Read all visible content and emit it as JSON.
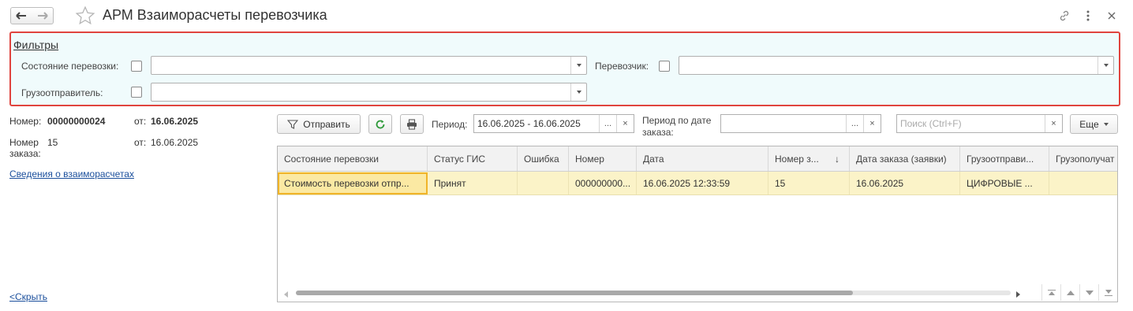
{
  "window": {
    "title": "АРМ Взаиморасчеты перевозчика"
  },
  "filters": {
    "header": "Фильтры",
    "state_label": "Состояние перевозки:",
    "carrier_label": "Перевозчик:",
    "shipper_label": "Грузоотправитель:"
  },
  "info": {
    "number_label": "Номер:",
    "number_value": "00000000024",
    "from_label_1": "от:",
    "date_1": "16.06.2025",
    "order_number_label_line1": "Номер",
    "order_number_label_line2": "заказа:",
    "order_number_value": "15",
    "from_label_2": "от:",
    "date_2": "16.06.2025",
    "settlements_link": "Сведения о взаиморасчетах",
    "hide_link": "<Скрыть"
  },
  "toolbar": {
    "send_label": "Отправить",
    "period_label": "Период:",
    "period_value": "16.06.2025 - 16.06.2025",
    "order_period_label_line1": "Период по дате",
    "order_period_label_line2": "заказа:",
    "search_placeholder": "Поиск (Ctrl+F)",
    "more_label": "Еще",
    "ellipsis": "...",
    "clear": "×"
  },
  "table": {
    "columns": [
      "Состояние перевозки",
      "Статус ГИС",
      "Ошибка",
      "Номер",
      "Дата",
      "Номер з...",
      "Дата заказа (заявки)",
      "Грузоотправи...",
      "Грузополучат"
    ],
    "sort_indicator": "↓",
    "rows": [
      {
        "state": "Стоимость перевозки отпр...",
        "gis_status": "Принят",
        "error": "",
        "number": "000000000...",
        "date": "16.06.2025 12:33:59",
        "order_number": "15",
        "order_date": "16.06.2025",
        "shipper": "ЦИФРОВЫЕ ...",
        "consignee": ""
      }
    ]
  },
  "colors": {
    "filter_border": "#e0443e",
    "filter_bg": "#f0fbfc",
    "row_highlight": "#fbf3c8",
    "selected_cell_border": "#f0b429",
    "link": "#1b4f9c"
  }
}
